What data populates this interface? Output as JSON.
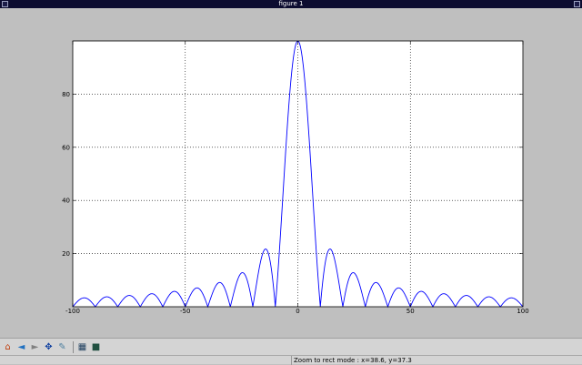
{
  "window": {
    "title": "figure 1"
  },
  "toolbar": {
    "buttons": [
      {
        "name": "home-icon",
        "glyph": "⌂",
        "color": "#c04010"
      },
      {
        "name": "back-icon",
        "glyph": "◄",
        "color": "#2070c0"
      },
      {
        "name": "forward-icon",
        "glyph": "►",
        "color": "#808080"
      },
      {
        "name": "pan-icon",
        "glyph": "✥",
        "color": "#1040a0"
      },
      {
        "name": "zoom-icon",
        "glyph": "✎",
        "color": "#5080a0"
      },
      {
        "name": "subplots-icon",
        "glyph": "▦",
        "color": "#204060"
      },
      {
        "name": "save-icon",
        "glyph": "■",
        "color": "#205040"
      }
    ]
  },
  "status": {
    "text": "Zoom to rect mode : x=38.6, y=37.3"
  },
  "colors": {
    "line": "#0000ff",
    "grid": "#000000",
    "axes_bg": "#ffffff",
    "figure_bg": "#bfbfbf"
  },
  "chart_data": {
    "type": "line",
    "title": "",
    "xlabel": "",
    "ylabel": "",
    "xlim": [
      -100,
      100
    ],
    "ylim": [
      0,
      100
    ],
    "xticks": [
      -100,
      -50,
      0,
      50,
      100
    ],
    "xtick_labels": [
      "-100",
      "-50",
      "0",
      "50",
      "100"
    ],
    "yticks": [
      20,
      40,
      60,
      80
    ],
    "ytick_labels": [
      "20",
      "40",
      "60",
      "80"
    ],
    "grid": true,
    "series": [
      {
        "function": "abs(100*sin(pi*x/10)/(pi*x/10))",
        "x": [
          -100,
          -95,
          -90,
          -85,
          -80,
          -75,
          -70,
          -65,
          -60,
          -55,
          -50,
          -45,
          -40,
          -35,
          -30,
          -25,
          -20,
          -15,
          -10,
          -5,
          0,
          5,
          10,
          15,
          20,
          25,
          30,
          35,
          40,
          45,
          50,
          55,
          60,
          65,
          70,
          75,
          80,
          85,
          90,
          95,
          100
        ],
        "y": [
          0,
          3.4,
          0,
          3.7,
          0,
          4.2,
          0,
          4.9,
          0,
          5.8,
          0,
          7.1,
          0,
          9.1,
          0,
          12.7,
          0,
          21.2,
          0,
          63.7,
          100,
          63.7,
          0,
          21.2,
          0,
          12.7,
          0,
          9.1,
          0,
          7.1,
          0,
          5.8,
          0,
          4.9,
          0,
          4.2,
          0,
          3.7,
          0,
          3.4,
          0
        ]
      }
    ]
  }
}
